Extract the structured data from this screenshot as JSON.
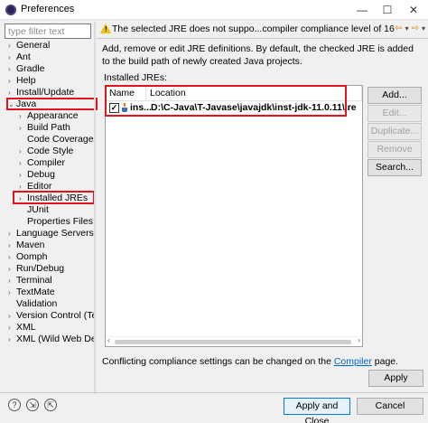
{
  "window": {
    "title": "Preferences",
    "minimize_glyph": "—",
    "maximize_glyph": "☐",
    "close_glyph": "✕"
  },
  "filter": {
    "placeholder": "type filter text",
    "value": ""
  },
  "tree": {
    "items": [
      {
        "label": "General",
        "expander": "›"
      },
      {
        "label": "Ant",
        "expander": "›"
      },
      {
        "label": "Gradle",
        "expander": "›"
      },
      {
        "label": "Help",
        "expander": "›"
      },
      {
        "label": "Install/Update",
        "expander": "›"
      },
      {
        "label": "Java",
        "expander": "⌄"
      },
      {
        "label": "Appearance",
        "expander": "›"
      },
      {
        "label": "Build Path",
        "expander": "›"
      },
      {
        "label": "Code Coverage",
        "expander": ""
      },
      {
        "label": "Code Style",
        "expander": "›"
      },
      {
        "label": "Compiler",
        "expander": "›"
      },
      {
        "label": "Debug",
        "expander": "›"
      },
      {
        "label": "Editor",
        "expander": "›"
      },
      {
        "label": "Installed JREs",
        "expander": "›"
      },
      {
        "label": "JUnit",
        "expander": ""
      },
      {
        "label": "Properties Files E",
        "expander": ""
      },
      {
        "label": "Language Servers",
        "expander": "›"
      },
      {
        "label": "Maven",
        "expander": "›"
      },
      {
        "label": "Oomph",
        "expander": "›"
      },
      {
        "label": "Run/Debug",
        "expander": "›"
      },
      {
        "label": "Terminal",
        "expander": "›"
      },
      {
        "label": "TextMate",
        "expander": "›"
      },
      {
        "label": "Validation",
        "expander": ""
      },
      {
        "label": "Version Control (Te",
        "expander": "›"
      },
      {
        "label": "XML",
        "expander": "›"
      },
      {
        "label": "XML (Wild Web Dev",
        "expander": "›"
      }
    ]
  },
  "header": {
    "message": "The selected JRE does not suppo...compiler compliance level of 16",
    "warning_glyph": "!",
    "back_glyph": "⇦",
    "forward_glyph": "⇨",
    "dropdown_glyph": "▾",
    "warning_color": "#f2c200",
    "nav_color": "#d48a00"
  },
  "page": {
    "description": "Add, remove or edit JRE definitions. By default, the checked JRE is added to the build path of newly created Java projects.",
    "installed_label": "Installed JREs:",
    "columns": [
      "Name",
      "Location"
    ],
    "rows": [
      {
        "checked": true,
        "check_glyph": "✓",
        "name": "ins...",
        "location": "D:\\C-Java\\T-Javase\\javajdk\\inst-jdk-11.0.11\\jre"
      }
    ],
    "scroll_left_glyph": "‹",
    "scroll_right_glyph": "›",
    "compliance_prefix": "Conflicting compliance settings can be changed on the ",
    "compliance_link": "Compiler",
    "compliance_suffix": " page."
  },
  "buttons": {
    "add": "Add...",
    "edit": "Edit...",
    "duplicate": "Duplicate...",
    "remove": "Remove",
    "search": "Search...",
    "apply": "Apply",
    "apply_close": "Apply and Close",
    "cancel": "Cancel"
  },
  "footer": {
    "help_glyph": "?",
    "import_glyph": "⇲",
    "export_glyph": "⇱"
  },
  "colors": {
    "highlight": "#e0141e",
    "link": "#0066cc",
    "primary_border": "#0078d7"
  }
}
